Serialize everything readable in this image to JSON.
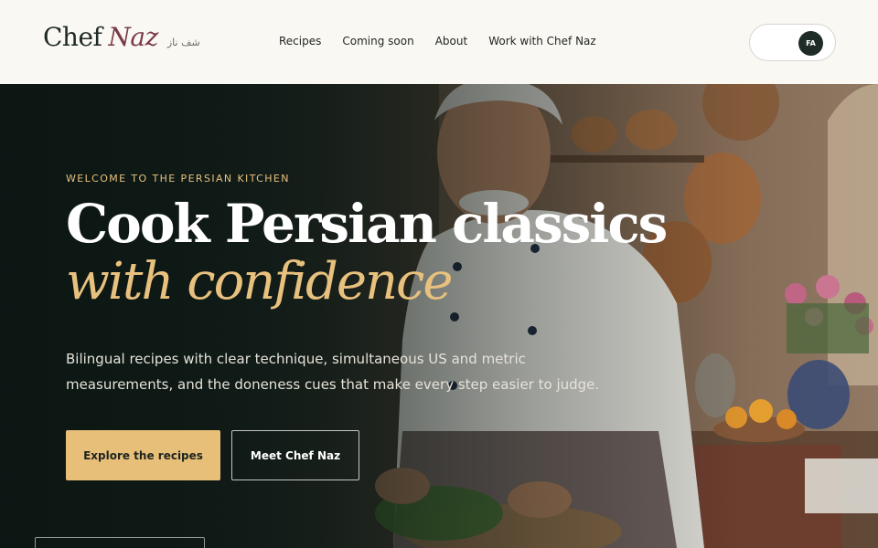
{
  "header": {
    "logo": {
      "first": "Chef",
      "second": "Naz",
      "farsi": "شف ناز"
    },
    "nav": [
      {
        "label": "Recipes"
      },
      {
        "label": "Coming soon"
      },
      {
        "label": "About"
      },
      {
        "label": "Work with Chef Naz"
      }
    ],
    "language_toggle": {
      "active": "FA"
    }
  },
  "hero": {
    "eyebrow": "WELCOME TO THE PERSIAN KITCHEN",
    "headline_line1": "Cook Persian classics",
    "headline_line2": "with confidence",
    "subtext": "Bilingual recipes with clear technique, simultaneous US and metric measurements, and the doneness cues that make every step easier to judge.",
    "primary_button": "Explore the recipes",
    "secondary_button": "Meet Chef Naz"
  },
  "colors": {
    "accent_gold": "#e8bf78",
    "brand_plum": "#7a3b45",
    "dark_green": "#1e2b26"
  }
}
